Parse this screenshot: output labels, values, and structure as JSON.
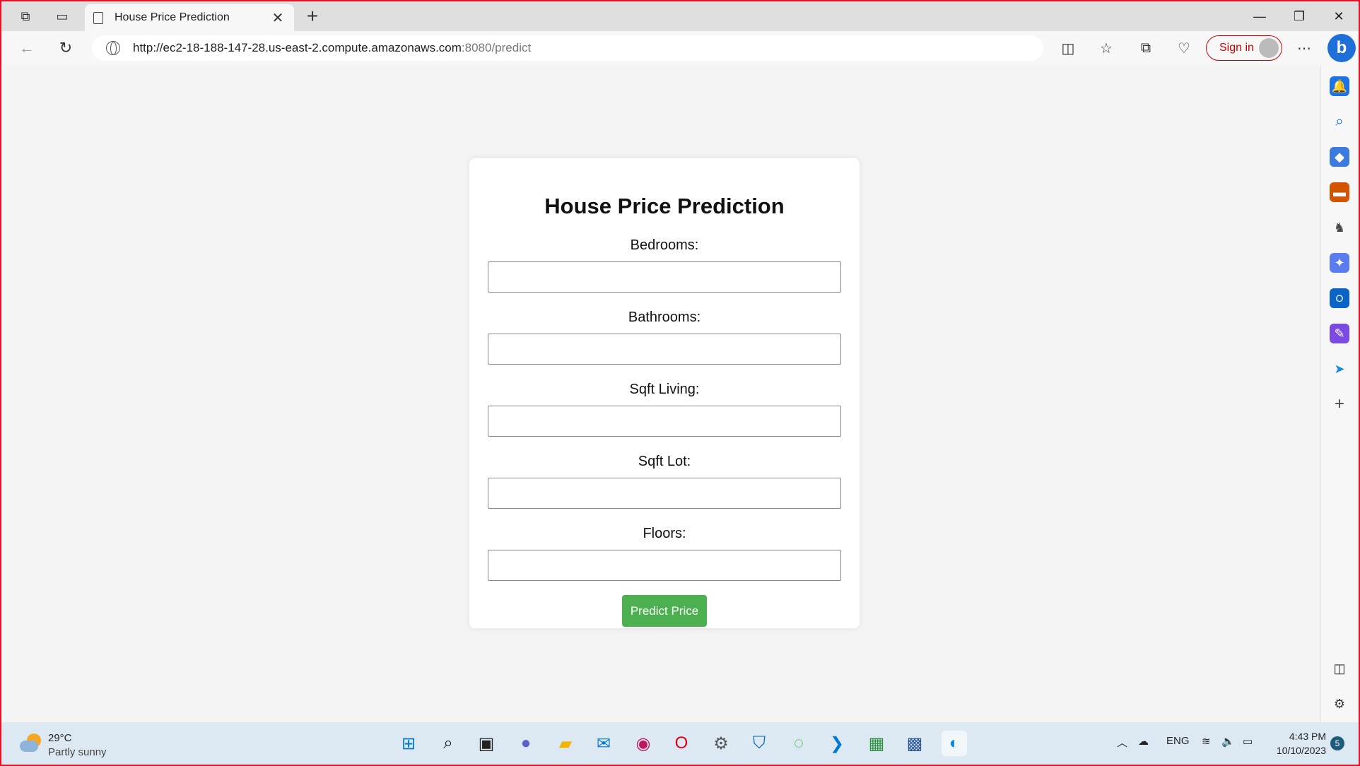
{
  "browser": {
    "tab_title": "House Price Prediction",
    "url_host": "http://ec2-18-188-147-28.us-east-2.compute.amazonaws.com",
    "url_path": ":8080/predict",
    "sign_in_label": "Sign in",
    "bing_label": "b"
  },
  "page": {
    "heading": "House Price Prediction",
    "fields": [
      {
        "label": "Bedrooms:",
        "value": ""
      },
      {
        "label": "Bathrooms:",
        "value": ""
      },
      {
        "label": "Sqft Living:",
        "value": ""
      },
      {
        "label": "Sqft Lot:",
        "value": ""
      },
      {
        "label": "Floors:",
        "value": ""
      }
    ],
    "submit_label": "Predict Price",
    "submit_color": "#4caf50"
  },
  "sidebar": {
    "icons": [
      "bell-icon",
      "search-icon",
      "tag-icon",
      "toolbox-icon",
      "chess-icon",
      "copilot-icon",
      "outlook-icon",
      "designer-icon",
      "send-icon",
      "plus-icon",
      "split-view-icon",
      "settings-icon"
    ]
  },
  "taskbar": {
    "temperature": "29°C",
    "condition": "Partly sunny",
    "language": "ENG",
    "time": "4:43 PM",
    "date": "10/10/2023",
    "notification_count": "5"
  }
}
